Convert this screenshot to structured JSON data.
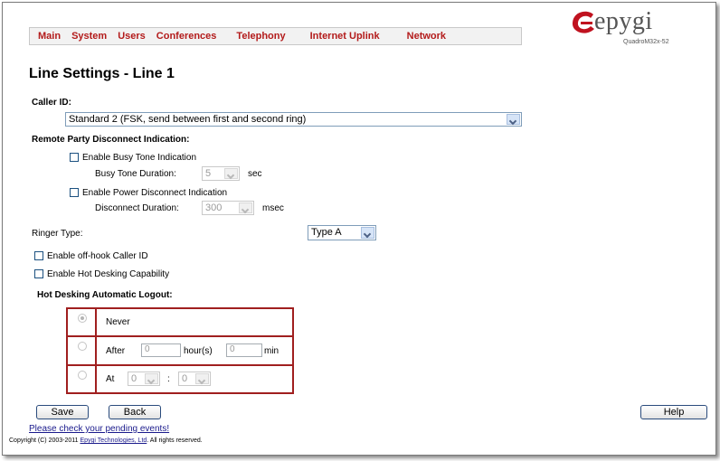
{
  "nav": {
    "items": [
      "Main",
      "System",
      "Users",
      "Conferences",
      "Telephony",
      "Internet Uplink",
      "Network"
    ]
  },
  "logo": {
    "word": "epygi",
    "model": "QuadroM32x-52"
  },
  "page_title": "Line Settings - Line 1",
  "caller_id": {
    "label": "Caller ID:",
    "value": "Standard 2 (FSK, send between first and second ring)"
  },
  "remote_disconnect": {
    "label": "Remote Party Disconnect Indication:",
    "busy_tone_label": "Enable Busy Tone Indication",
    "busy_duration_label": "Busy Tone Duration:",
    "busy_duration_value": "5",
    "busy_unit": "sec",
    "power_label": "Enable Power Disconnect Indication",
    "disconnect_duration_label": "Disconnect Duration:",
    "disconnect_duration_value": "300",
    "disconnect_unit": "msec"
  },
  "ringer": {
    "label": "Ringer Type:",
    "value": "Type A"
  },
  "offhook_label": "Enable off-hook Caller ID",
  "hot_desking_label": "Enable Hot Desking Capability",
  "logout": {
    "label": "Hot Desking Automatic Logout:",
    "never_label": "Never",
    "after_label": "After",
    "hours_value": "0",
    "hours_unit": "hour(s)",
    "minutes_value": "0",
    "minutes_unit": "min",
    "at_label": "At",
    "at_hour": "0",
    "at_separator": ":",
    "at_minute": "0"
  },
  "buttons": {
    "save": "Save",
    "back": "Back",
    "help": "Help"
  },
  "pending_link": "Please check your pending events!",
  "footer": {
    "prefix": "Copyright (C) 2003-2011 ",
    "company": "Epygi Technologies, Ltd",
    "suffix": ". All rights reserved."
  },
  "colors": {
    "nav_text": "#b31b1b",
    "table_border": "#a01f1f",
    "logo_red": "#c0121f",
    "link": "#1a1a8c"
  }
}
